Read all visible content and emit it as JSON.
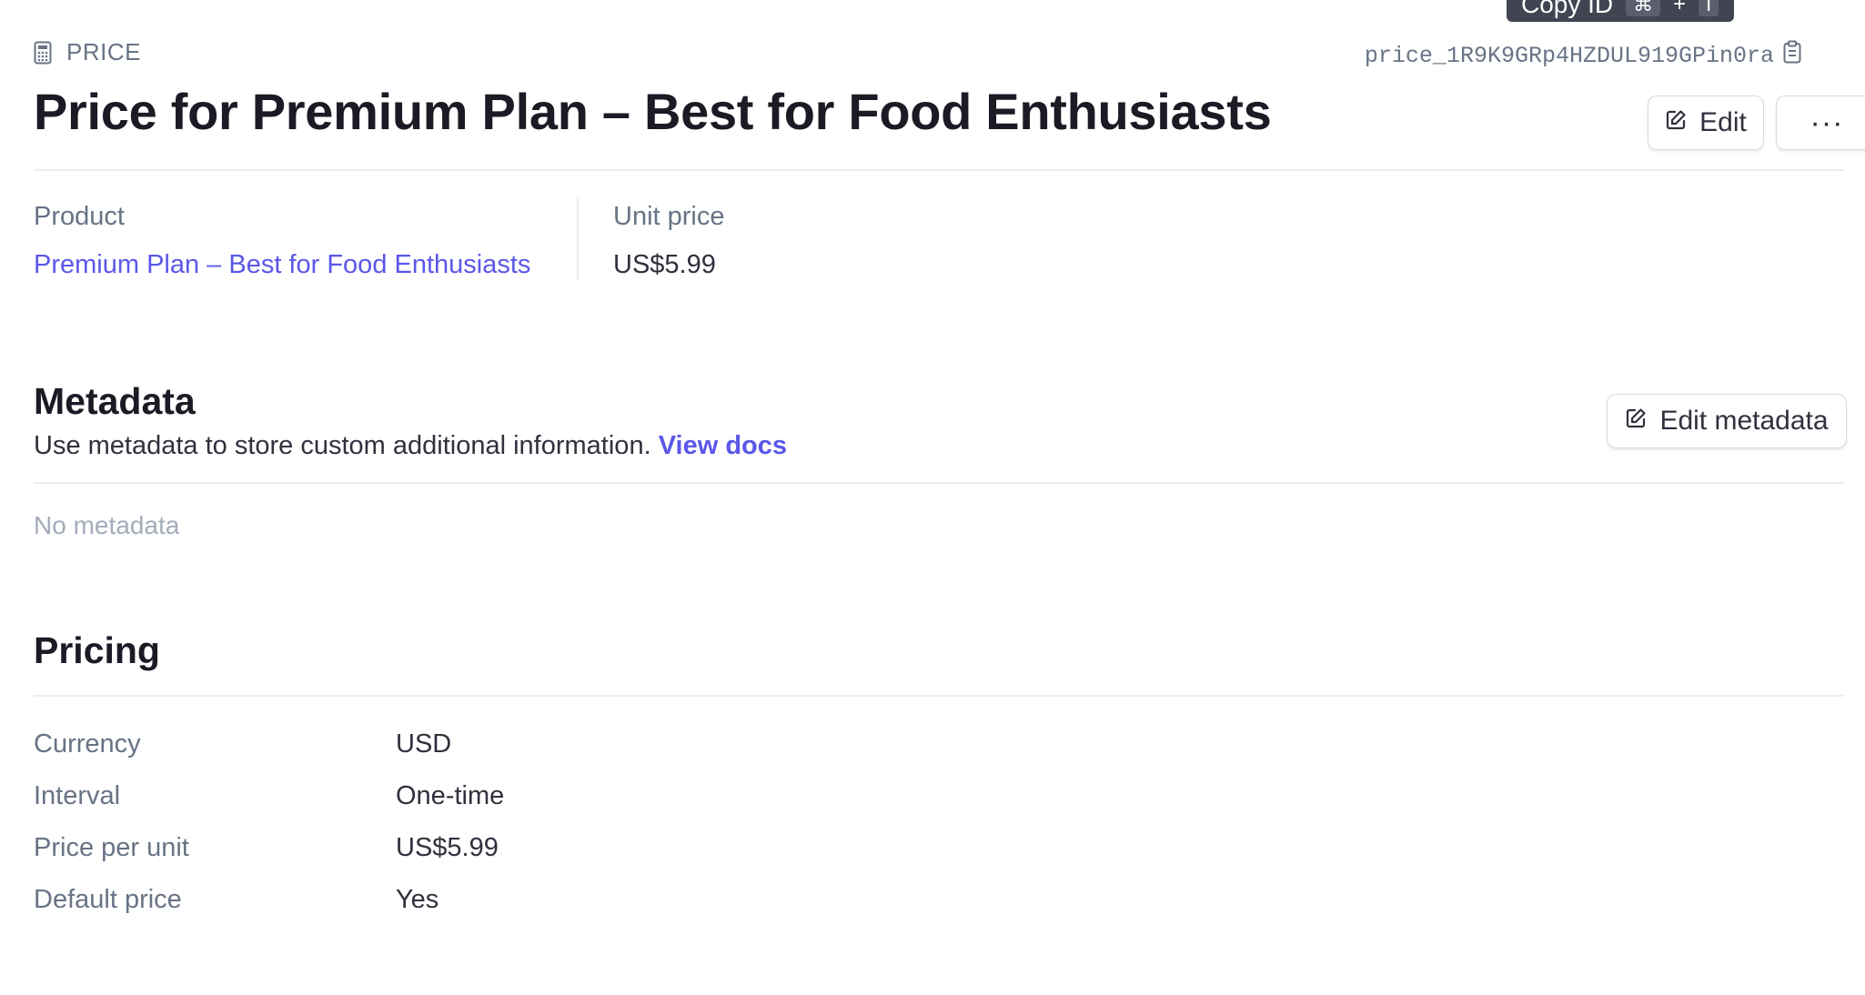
{
  "tooltip": {
    "label": "Copy ID",
    "key1": "⌘",
    "plus": "+",
    "key2": "I"
  },
  "header": {
    "type_label": "PRICE",
    "price_id": "price_1R9K9GRp4HZDUL919GPin0ra",
    "title": "Price for Premium Plan – Best for Food Enthusiasts",
    "edit_label": "Edit",
    "more_label": "···"
  },
  "summary": {
    "product_label": "Product",
    "product_value": "Premium Plan – Best for Food Enthusiasts",
    "unit_price_label": "Unit price",
    "unit_price_value": "US$5.99"
  },
  "metadata": {
    "title": "Metadata",
    "description": "Use metadata to store custom additional information.",
    "docs_link": "View docs",
    "edit_label": "Edit metadata",
    "empty_text": "No metadata"
  },
  "pricing": {
    "title": "Pricing",
    "rows": [
      {
        "label": "Currency",
        "value": "USD"
      },
      {
        "label": "Interval",
        "value": "One-time"
      },
      {
        "label": "Price per unit",
        "value": "US$5.99"
      },
      {
        "label": "Default price",
        "value": "Yes"
      }
    ]
  },
  "colors": {
    "accent": "#5b57e8",
    "muted": "#687385",
    "text": "#1a1b25"
  },
  "icons": {
    "type": "calculator-icon",
    "copy": "clipboard-icon",
    "edit": "pencil-square-icon"
  }
}
